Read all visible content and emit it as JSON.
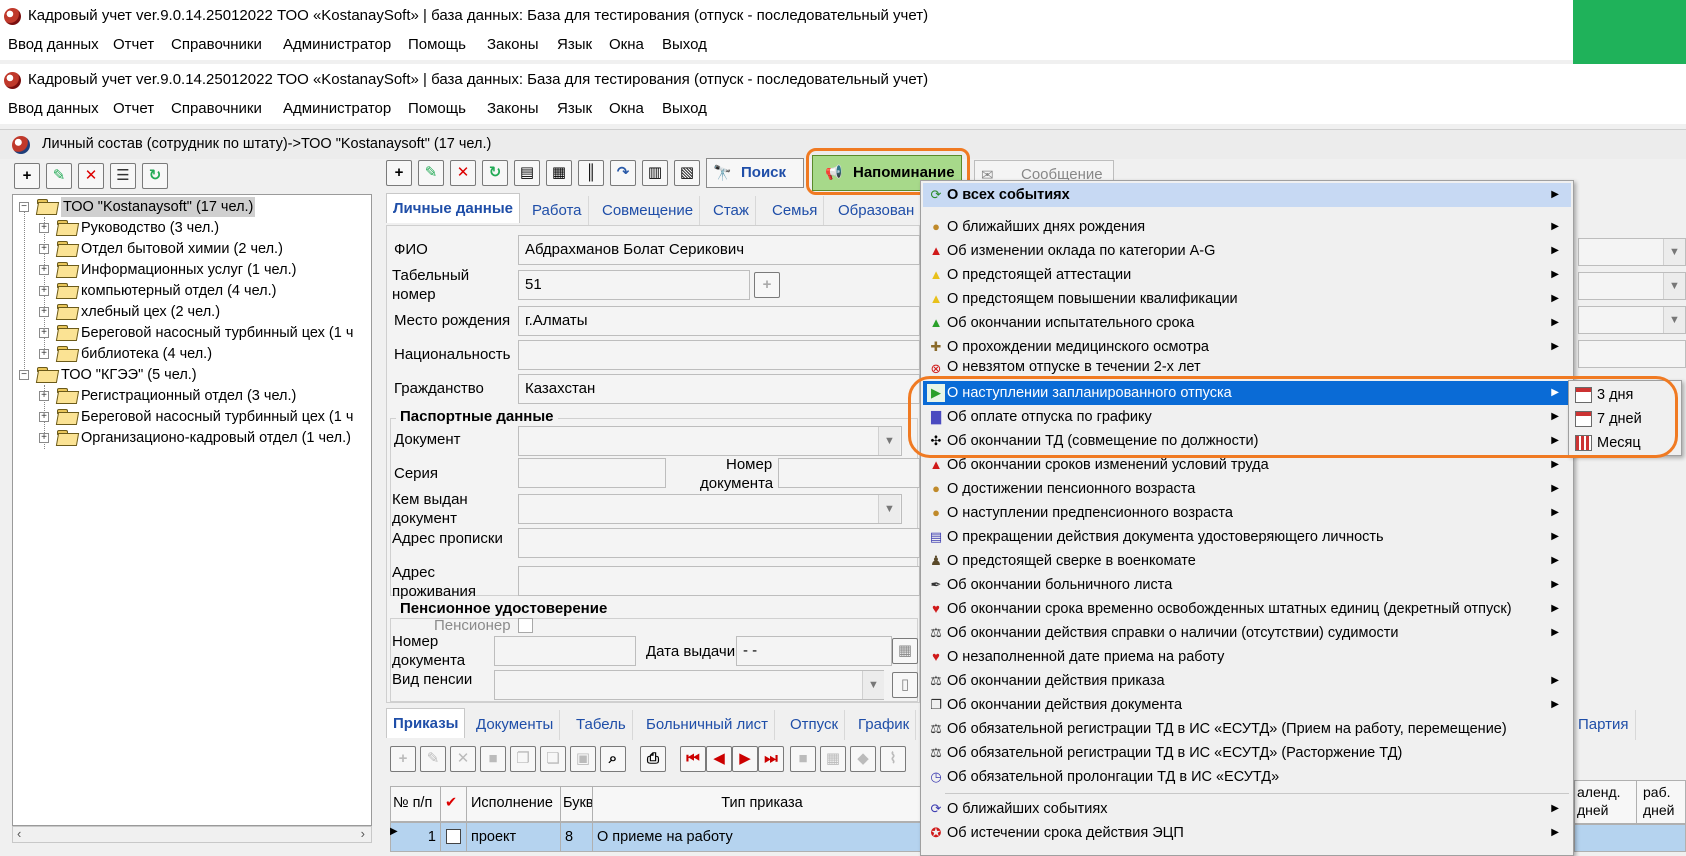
{
  "app_title": "Кадровый учет ver.9.0.14.25012022 ТОО «KostanaySoft» | база данных: База для тестирования (отпуск - последовательный учет)",
  "main_menu": [
    "Ввод данных",
    "Отчет",
    "Справочники",
    "Администратор",
    "Помощь",
    "Законы",
    "Язык",
    "Окна",
    "Выход"
  ],
  "subwindow_title": "Личный состав (сотрудник по штату)->ТОО \"Kostanaysoft\" (17 чел.)",
  "tree": {
    "org1": "ТОО \"Kostanaysoft\" (17 чел.)",
    "org1_children": [
      "Руководство (3 чел.)",
      "Отдел бытовой химии (2 чел.)",
      "Информационных услуг (1 чел.)",
      "компьютерный отдел (4 чел.)",
      "хлебный цех (2 чел.)",
      "Береговой насосный турбинный цех (1 ч",
      "библиотека (4 чел.)"
    ],
    "org2": "ТОО \"КГЭЭ\" (5 чел.)",
    "org2_children": [
      "Регистрационный отдел (3 чел.)",
      "Береговой насосный турбинный цех (1 ч",
      "Организационо-кадровый отдел (1 чел.)"
    ]
  },
  "toolbar": {
    "search": "Поиск",
    "reminder": "Напоминание",
    "message": "Сообщение"
  },
  "tabs": [
    "Личные данные",
    "Работа",
    "Совмещение",
    "Стаж",
    "Семья",
    "Образован"
  ],
  "form": {
    "fio_label": "ФИО",
    "fio_value": "Абдрахманов Болат Серикович",
    "tab_label_1": "Табельный",
    "tab_label_2": "номер",
    "tab_value": "51",
    "birthplace_label": "Место рождения",
    "birthplace_value": "г.Алматы",
    "nationality_label": "Национальность",
    "citizenship_label": "Гражданство",
    "citizenship_value": "Казахстан",
    "passport_group": "Паспортные данные",
    "doc_label": "Документ",
    "series_label": "Серия",
    "docnum_label_1": "Номер",
    "docnum_label_2": "документа",
    "issued_label_1": "Кем выдан",
    "issued_label_2": "документ",
    "reg_address_label": "Адрес прописки",
    "live_address_label_1": "Адрес",
    "live_address_label_2": "проживания",
    "pension_group": "Пенсионное удостоверение",
    "pensioner_label": "Пенсионер",
    "pnum_label_1": "Номер",
    "pnum_label_2": "документа",
    "issue_date_label": "Дата выдачи",
    "issue_date_value": "- -",
    "pension_type_label": "Вид пенсии"
  },
  "bottom_tabs": [
    "Приказы",
    "Документы",
    "Табель",
    "Больничный лист",
    "Отпуск",
    "График"
  ],
  "bottom_tab_right": "Партия",
  "table": {
    "headers": [
      "№ п/п",
      "✔",
      "Исполнение",
      "Букв",
      "Тип приказа"
    ],
    "right_headers_1": [
      "аленд.",
      "раб."
    ],
    "right_headers_2": [
      "дней",
      "дней"
    ],
    "row": [
      "1",
      "",
      "проект",
      "8",
      "О приеме на работу"
    ]
  },
  "reminder_menu": [
    {
      "label": "О всех событиях",
      "icon": "refresh-icon",
      "arrow": true,
      "state": "hover"
    },
    {
      "label": "О ближайших днях рождения",
      "icon": "person-icon",
      "arrow": true
    },
    {
      "label": "Об изменении оклада по категории A-G",
      "icon": "warning-red-icon",
      "arrow": true
    },
    {
      "label": "О предстоящей аттестации",
      "icon": "warning-yellow-icon",
      "arrow": true
    },
    {
      "label": "О предстоящем повышении квалификации",
      "icon": "warning-yellow-icon",
      "arrow": true
    },
    {
      "label": "Об окончании испытательного срока",
      "icon": "warning-green-icon",
      "arrow": true
    },
    {
      "label": "О прохождении медицинского осмотра",
      "icon": "medical-icon",
      "arrow": true
    },
    {
      "label": "О невзятом отпуске в течении 2-х лет",
      "icon": "cancel-icon",
      "arrow": false
    },
    {
      "label": "О наступлении запланированного отпуска",
      "icon": "play-icon",
      "arrow": true,
      "state": "selected"
    },
    {
      "label": "Об оплате отпуска по графику",
      "icon": "bar-chart-icon",
      "arrow": true
    },
    {
      "label": "Об окончании ТД (совмещение по должности)",
      "icon": "contract-icon",
      "arrow": true
    },
    {
      "label": "Об окончании сроков изменений условий труда",
      "icon": "warning-red-icon",
      "arrow": true
    },
    {
      "label": "О достижении пенсионного возраста",
      "icon": "person-icon",
      "arrow": true
    },
    {
      "label": "О наступлении предпенсионного возраста",
      "icon": "person-icon",
      "arrow": true
    },
    {
      "label": "О прекращении действия документа удостоверяющего личность",
      "icon": "id-card-icon",
      "arrow": true
    },
    {
      "label": "О предстоящей сверке в военкомате",
      "icon": "soldier-icon",
      "arrow": true
    },
    {
      "label": "Об окончании больничного листа",
      "icon": "pen-icon",
      "arrow": true
    },
    {
      "label": "Об окончании срока временно освобожденных штатных единиц (декретный отпуск)",
      "icon": "heart-icon",
      "arrow": true
    },
    {
      "label": "Об окончании действия справки о наличии (отсутствии) судимости",
      "icon": "scales-icon",
      "arrow": true
    },
    {
      "label": "О незаполненной дате приема на работу",
      "icon": "heart-icon",
      "arrow": false
    },
    {
      "label": "Об окончании действия приказа",
      "icon": "scales-icon",
      "arrow": true
    },
    {
      "label": "Об окончании действия документа",
      "icon": "documents-icon",
      "arrow": true
    },
    {
      "label": "Об обязательной регистрации ТД в ИС «ЕСУТД» (Прием на работу, перемещение)",
      "icon": "scales-icon",
      "arrow": false
    },
    {
      "label": "Об обязательной регистрации ТД в ИС «ЕСУТД» (Расторжение ТД)",
      "icon": "scales-icon",
      "arrow": false
    },
    {
      "label": "Об обязательной пролонгации ТД в ИС «ЕСУТД»",
      "icon": "clock-icon",
      "arrow": false
    },
    {
      "label": "О ближайших событиях",
      "icon": "events-icon",
      "arrow": true,
      "separator_before": true
    },
    {
      "label": "Об истечении срока действия ЭЦП",
      "icon": "certificate-icon",
      "arrow": true
    }
  ],
  "submenu": [
    "3 дня",
    "7 дней",
    "Месяц"
  ],
  "colors": {
    "highlight": "#0a6bd6",
    "hover": "#c7d9f3",
    "annotation": "#f07a22",
    "green_block": "#1fb25a"
  }
}
